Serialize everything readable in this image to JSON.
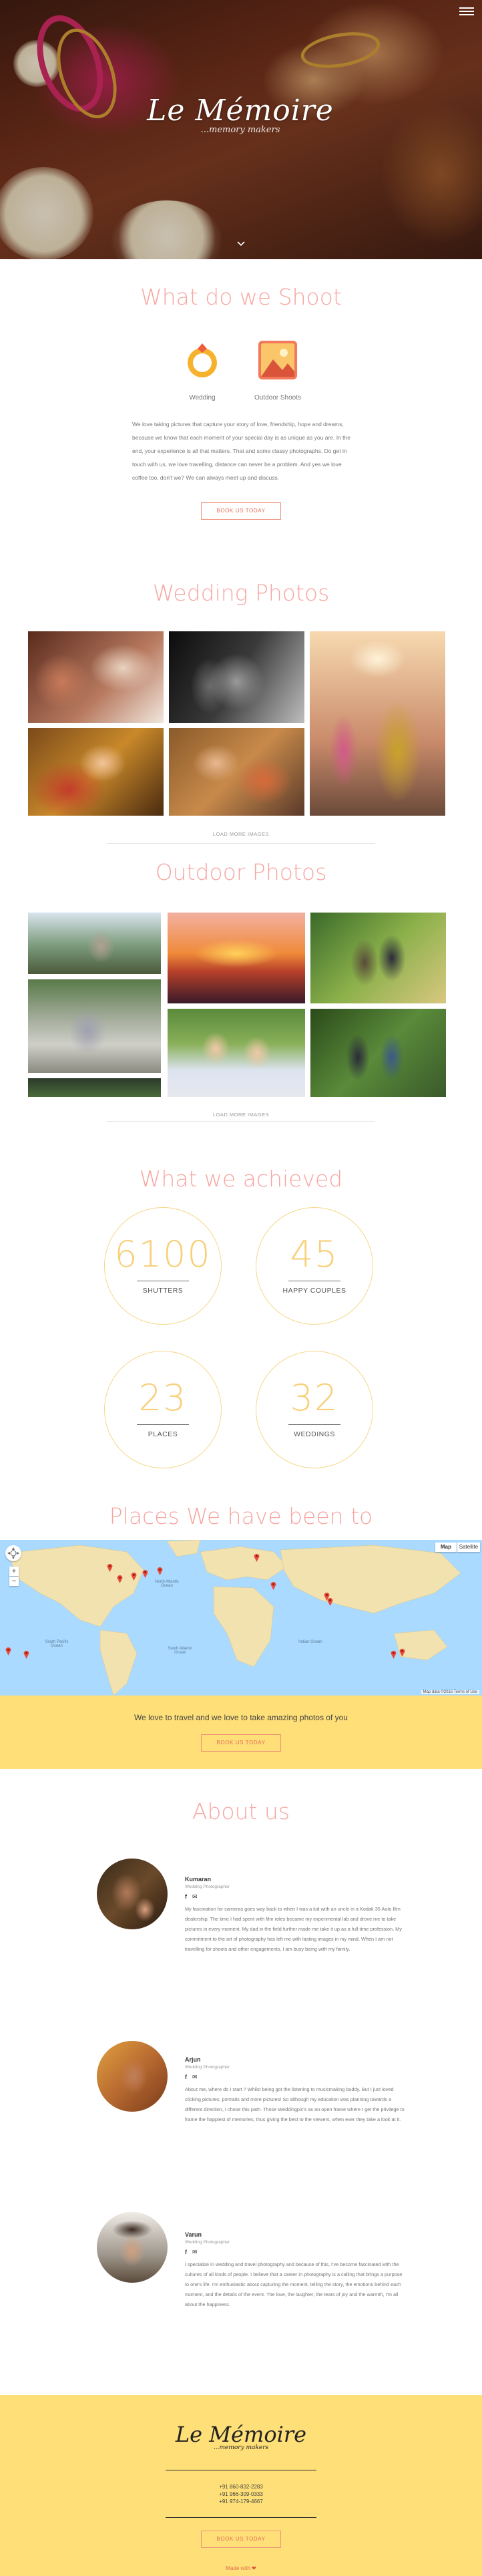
{
  "hero": {
    "logo_title": "Le Mémoire",
    "logo_tagline": "...memory makers"
  },
  "shoot": {
    "title": "What do we Shoot",
    "items": [
      {
        "label": "Wedding",
        "icon": "wedding-ring-icon"
      },
      {
        "label": "Outdoor Shoots",
        "icon": "landscape-photo-icon"
      }
    ],
    "description": "We love taking pictures that capture your story of love, friendship, hope and dreams, because we know that each moment of your special day is as unique as you are. In the end, your experience is all that matters. That and some classy photographs. Do get in touch with us, we love travelling, distance can never be a problem. And yes we love coffee too, don't we? We can always meet up and discuss.",
    "cta": "BOOK US TODAY"
  },
  "wedding": {
    "title": "Wedding Photos",
    "load_more": "LOAD MORE IMAGES"
  },
  "outdoor": {
    "title": "Outdoor Photos",
    "load_more": "LOAD MORE IMAGES"
  },
  "achieved": {
    "title": "What we achieved",
    "stats": [
      {
        "value": "6100",
        "label": "SHUTTERS"
      },
      {
        "value": "45",
        "label": "HAPPY COUPLES"
      },
      {
        "value": "23",
        "label": "PLACES"
      },
      {
        "value": "32",
        "label": "WEDDINGS"
      }
    ]
  },
  "places": {
    "title": "Places We have been to",
    "map_type_map": "Map",
    "map_type_satellite": "Satellite",
    "zoom_in": "+",
    "zoom_out": "−",
    "attribution": "Map data ©2016 Terms of Use",
    "ocean_labels": [
      "North Atlantic Ocean",
      "South Pacific Ocean",
      "Indian Ocean",
      "South Atlantic Ocean"
    ]
  },
  "travel": {
    "text": "We love to travel and we love to take amazing photos of you",
    "cta": "BOOK US TODAY"
  },
  "about": {
    "title": "About us",
    "people": [
      {
        "name": "Kumaran",
        "role": "Wedding Photographer",
        "text": "My fascination for cameras goes way back to when I was a kid with an uncle in a Kodak 35 Auto film dealership. The time I had spent with film roles became my experimental lab and drove me to take pictures in every moment. My dad in the field further made me take it up as a full-time profession. My commitment to the art of photography has left me with lasting images in my mind. When I am not travelling for shoots and other engagements, I am busy being with my family."
      },
      {
        "name": "Arjun",
        "role": "Wedding Photographer",
        "text": "About me, where do I start ? Whilst being got the listening to musicmaking buddy. But I just loved clicking pictures, portraits and more pictures! So although my education was planning towards a different direction, I chose this path. Those Weddingpic's as an open frame where I get the privilege to frame the happiest of memories, thus giving the best to the viewers, when ever they take a look at it."
      },
      {
        "name": "Varun",
        "role": "Wedding Photographer",
        "text": "I specialize in wedding and travel photography and because of this, I've become fascinated with the cultures of all kinds of people. I believe that a career in photography is a calling that brings a purpose to one's life. I'm enthusiastic about capturing the moment, telling the story, the emotions behind each moment, and the details of the event. The love, the laughter, the tears of joy and the warmth, I'm all about the happiness."
      }
    ]
  },
  "footer": {
    "logo_title": "Le Mémoire",
    "logo_tagline": "...memory makers",
    "phones": [
      "+91 860-832-2283",
      "+91 966-309-0333",
      "+91 974-179-4667"
    ],
    "cta": "BOOK US TODAY",
    "made_with": "Made with"
  },
  "colors": {
    "accent": "#f6a6a2",
    "cta": "#e66f55",
    "yellow": "#fedf78",
    "stat_ring": "#f7d88a"
  }
}
